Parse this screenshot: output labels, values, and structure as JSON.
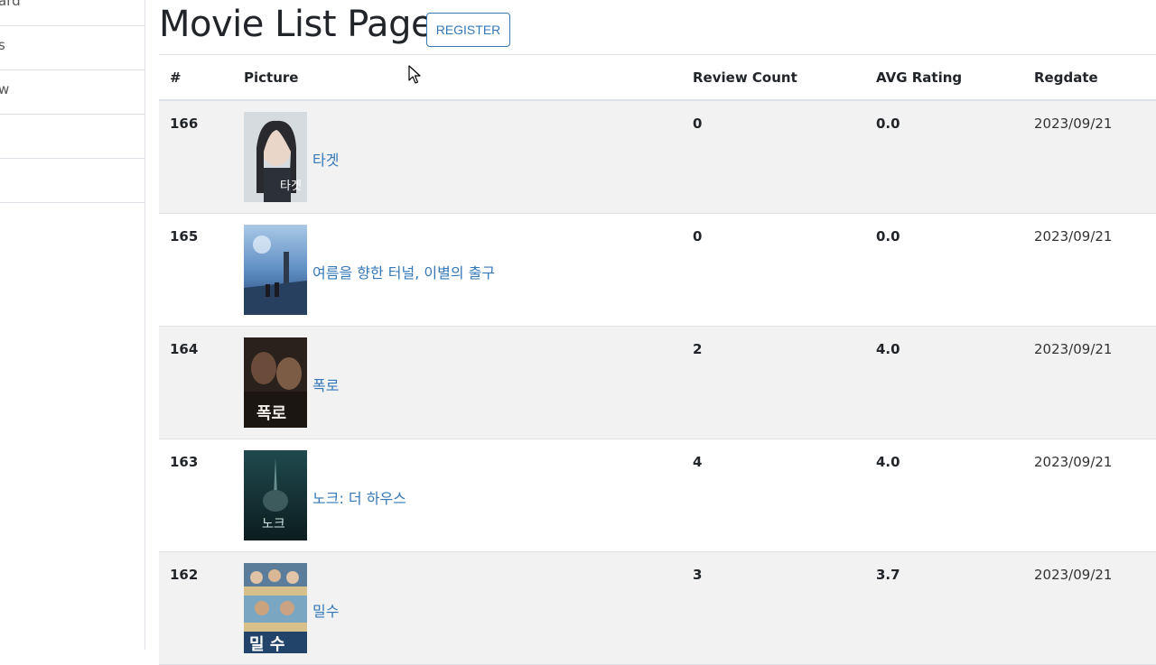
{
  "sidebar": {
    "items": [
      {
        "label": "ard"
      },
      {
        "label": "s"
      },
      {
        "label": "w"
      },
      {
        "label": ""
      },
      {
        "label": ""
      }
    ]
  },
  "header": {
    "title": "Movie List Page",
    "register_label": "REGISTER"
  },
  "table": {
    "columns": [
      "#",
      "Picture",
      "Review Count",
      "AVG Rating",
      "Regdate"
    ],
    "rows": [
      {
        "id": "166",
        "title": "타겟",
        "review_count": "0",
        "avg_rating": "0.0",
        "regdate": "2023/09/21"
      },
      {
        "id": "165",
        "title": "여름을 향한 터널, 이별의 출구",
        "review_count": "0",
        "avg_rating": "0.0",
        "regdate": "2023/09/21"
      },
      {
        "id": "164",
        "title": "폭로",
        "review_count": "2",
        "avg_rating": "4.0",
        "regdate": "2023/09/21"
      },
      {
        "id": "163",
        "title": "노크: 더 하우스",
        "review_count": "4",
        "avg_rating": "4.0",
        "regdate": "2023/09/21"
      },
      {
        "id": "162",
        "title": "밀수",
        "review_count": "3",
        "avg_rating": "3.7",
        "regdate": "2023/09/21"
      }
    ]
  },
  "colors": {
    "link": "#3578b8",
    "stripe": "#f2f2f2",
    "border": "#dee2e6"
  }
}
